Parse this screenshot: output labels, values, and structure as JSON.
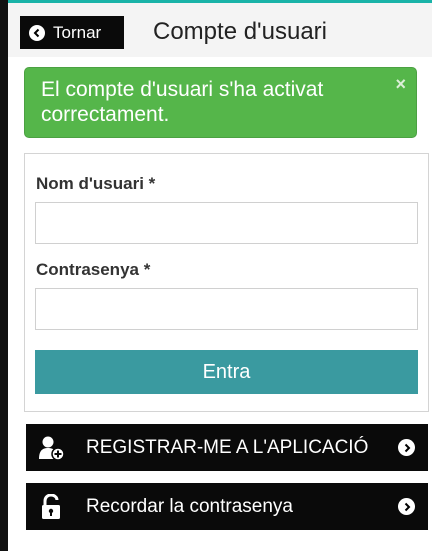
{
  "header": {
    "back_label": "Tornar",
    "title": "Compte d'usuari"
  },
  "alert": {
    "message": "El compte d'usuari s'ha activat correctament.",
    "close_glyph": "×",
    "color": "#55b64a"
  },
  "form": {
    "username_label": "Nom d'usuari *",
    "username_value": "",
    "password_label": "Contrasenya *",
    "password_value": "",
    "submit_label": "Entra",
    "submit_color": "#3a9aa0"
  },
  "actions": [
    {
      "label": "REGISTRAR-ME A L'APLICACIÓ",
      "icon": "add-user-icon"
    },
    {
      "label": "Recordar la contrasenya",
      "icon": "unlock-icon"
    }
  ]
}
